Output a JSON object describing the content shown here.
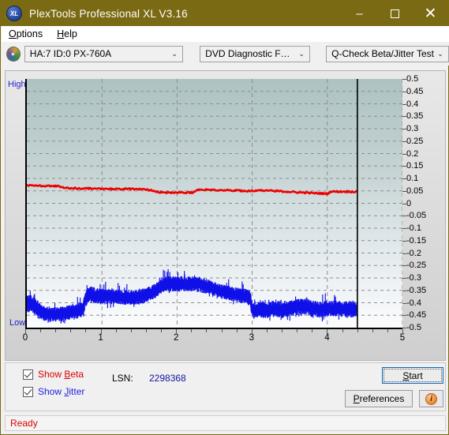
{
  "window": {
    "title": "PlexTools Professional XL V3.16",
    "app_icon": "xl-disc-icon",
    "minimize": "–",
    "maximize": "",
    "close": "✕"
  },
  "menubar": {
    "items": [
      {
        "label": "Options",
        "accel": "O"
      },
      {
        "label": "Help",
        "accel": "H"
      }
    ]
  },
  "toolbar": {
    "drive_icon": "disc-icon",
    "drive": {
      "value": "HA:7 ID:0  PX-760A"
    },
    "function": {
      "value": "DVD Diagnostic Functions"
    },
    "test": {
      "value": "Q-Check Beta/Jitter Test"
    },
    "chevron": "⌄"
  },
  "chart_panel": {
    "high_label": "High",
    "low_label": "Low"
  },
  "controls": {
    "show_beta": {
      "label_pre": "Show ",
      "label_accel": "B",
      "label_post": "eta",
      "checked": true,
      "color": "#dd0000"
    },
    "show_jitter": {
      "label_pre": "Show ",
      "label_accel": "J",
      "label_post": "itter",
      "checked": true,
      "color": "#2222dd"
    },
    "lsn_label": "LSN:",
    "lsn_value": "2298368",
    "start_button": {
      "pre": "",
      "accel": "S",
      "post": "tart"
    },
    "preferences_button": {
      "pre": "",
      "accel": "P",
      "post": "references"
    },
    "info_button": "i"
  },
  "statusbar": {
    "text": "Ready"
  },
  "chart_data": {
    "type": "line",
    "title": "Q-Check Beta/Jitter Test",
    "xlabel": "",
    "ylabel": "",
    "xlim": [
      0,
      5
    ],
    "ylim": [
      -0.5,
      0.5
    ],
    "xticks": [
      0,
      1,
      2,
      3,
      4,
      5
    ],
    "yticks": [
      0.5,
      0.45,
      0.4,
      0.35,
      0.3,
      0.25,
      0.2,
      0.15,
      0.1,
      0.05,
      0,
      -0.05,
      -0.1,
      -0.15,
      -0.2,
      -0.25,
      -0.3,
      -0.35,
      -0.4,
      -0.45,
      -0.5
    ],
    "ytick_labels": [
      "0.5",
      "0.45",
      "0.4",
      "0.35",
      "0.3",
      "0.25",
      "0.2",
      "0.15",
      "0.1",
      "0.05",
      "0",
      "-0.05",
      "-0.1",
      "-0.15",
      "-0.2",
      "-0.25",
      "-0.3",
      "-0.35",
      "-0.4",
      "-0.45",
      "-0.5"
    ],
    "grid": true,
    "data_end_x": 4.4,
    "end_marker": true,
    "series": [
      {
        "name": "Beta",
        "color": "#ee0000",
        "x": [
          0.0,
          0.1,
          0.2,
          0.3,
          0.4,
          0.5,
          0.6,
          0.7,
          0.8,
          0.9,
          1.0,
          1.1,
          1.2,
          1.3,
          1.4,
          1.5,
          1.6,
          1.7,
          1.75,
          1.8,
          1.9,
          2.0,
          2.1,
          2.2,
          2.3,
          2.4,
          2.5,
          2.6,
          2.7,
          2.8,
          2.9,
          3.0,
          3.05,
          3.1,
          3.2,
          3.3,
          3.4,
          3.5,
          3.6,
          3.7,
          3.8,
          3.9,
          4.0,
          4.05,
          4.1,
          4.2,
          4.3,
          4.4
        ],
        "values": [
          0.072,
          0.071,
          0.07,
          0.07,
          0.069,
          0.062,
          0.06,
          0.06,
          0.06,
          0.059,
          0.059,
          0.058,
          0.058,
          0.058,
          0.058,
          0.057,
          0.055,
          0.05,
          0.046,
          0.044,
          0.043,
          0.043,
          0.043,
          0.043,
          0.056,
          0.055,
          0.054,
          0.053,
          0.052,
          0.051,
          0.05,
          0.05,
          0.052,
          0.052,
          0.051,
          0.05,
          0.048,
          0.046,
          0.044,
          0.043,
          0.041,
          0.04,
          0.038,
          0.048,
          0.047,
          0.047,
          0.047,
          0.046
        ]
      },
      {
        "name": "Jitter",
        "color": "#1010e8",
        "band": true,
        "x": [
          0.0,
          0.05,
          0.1,
          0.15,
          0.2,
          0.25,
          0.3,
          0.35,
          0.4,
          0.45,
          0.5,
          0.55,
          0.6,
          0.65,
          0.7,
          0.75,
          0.78,
          0.82,
          0.9,
          1.0,
          1.1,
          1.2,
          1.3,
          1.4,
          1.5,
          1.6,
          1.7,
          1.8,
          1.85,
          1.9,
          2.0,
          2.1,
          2.2,
          2.3,
          2.4,
          2.5,
          2.6,
          2.7,
          2.8,
          2.9,
          2.97,
          3.0,
          3.1,
          3.2,
          3.3,
          3.4,
          3.5,
          3.6,
          3.7,
          3.8,
          3.9,
          4.0,
          4.1,
          4.2,
          4.3,
          4.4
        ],
        "upper": [
          -0.38,
          -0.375,
          -0.385,
          -0.4,
          -0.41,
          -0.42,
          -0.425,
          -0.425,
          -0.425,
          -0.42,
          -0.42,
          -0.415,
          -0.412,
          -0.41,
          -0.405,
          -0.4,
          -0.36,
          -0.34,
          -0.345,
          -0.35,
          -0.35,
          -0.352,
          -0.355,
          -0.355,
          -0.35,
          -0.345,
          -0.33,
          -0.305,
          -0.295,
          -0.3,
          -0.3,
          -0.302,
          -0.3,
          -0.3,
          -0.31,
          -0.322,
          -0.332,
          -0.34,
          -0.345,
          -0.35,
          -0.355,
          -0.4,
          -0.405,
          -0.405,
          -0.398,
          -0.4,
          -0.398,
          -0.39,
          -0.388,
          -0.398,
          -0.402,
          -0.4,
          -0.398,
          -0.4,
          -0.402,
          -0.4
        ],
        "lower": [
          -0.43,
          -0.43,
          -0.44,
          -0.455,
          -0.462,
          -0.468,
          -0.47,
          -0.47,
          -0.47,
          -0.468,
          -0.468,
          -0.465,
          -0.462,
          -0.46,
          -0.455,
          -0.448,
          -0.412,
          -0.392,
          -0.395,
          -0.4,
          -0.398,
          -0.4,
          -0.402,
          -0.403,
          -0.4,
          -0.392,
          -0.378,
          -0.352,
          -0.345,
          -0.348,
          -0.348,
          -0.35,
          -0.348,
          -0.35,
          -0.358,
          -0.368,
          -0.378,
          -0.385,
          -0.392,
          -0.398,
          -0.405,
          -0.452,
          -0.455,
          -0.455,
          -0.45,
          -0.452,
          -0.45,
          -0.442,
          -0.44,
          -0.448,
          -0.452,
          -0.45,
          -0.448,
          -0.45,
          -0.452,
          -0.45
        ]
      }
    ]
  }
}
